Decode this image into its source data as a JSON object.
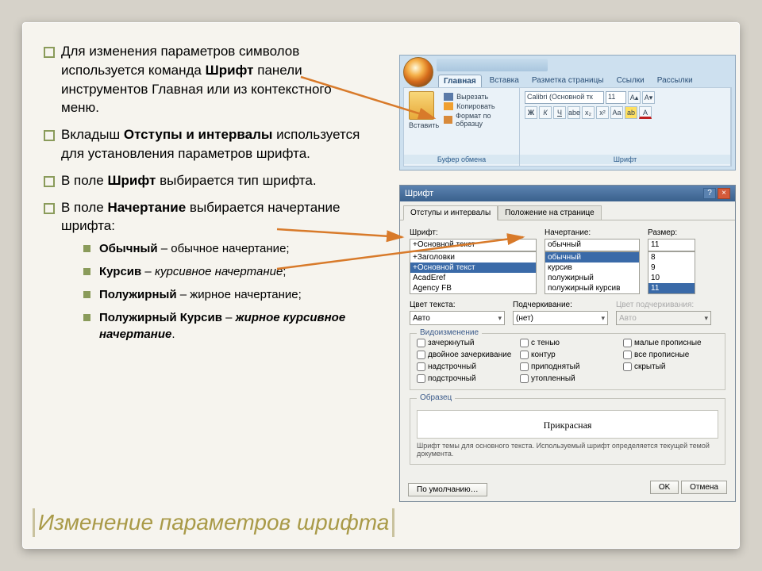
{
  "title": "Изменение параметров шрифта",
  "bullets": {
    "b1_pre": "Для изменения параметров символов используется команда ",
    "b1_bold": "Шрифт",
    "b1_post": " панели инструментов Главная или из контекстного меню.",
    "b2_pre": "Вкладыш ",
    "b2_bold": "Отступы и интервалы",
    "b2_post": " используется для установления параметров шрифта.",
    "b3_pre": "В поле  ",
    "b3_bold": "Шрифт",
    "b3_post": " выбирается тип шрифта.",
    "b4_pre": "В поле   ",
    "b4_bold": "Начертание",
    "b4_post": " выбирается начертание шрифта:",
    "i1_bold": "Обычный",
    "i1_post": " – обычное начертание;",
    "i2_bold": "Курсив",
    "i2_post": " – ",
    "i2_ital": "курсивное начертание",
    "i2_end": ";",
    "i3_bold": "Полужирный",
    "i3_post": " – жирное начертание;",
    "i4_bold": "Полужирный Курсив",
    "i4_post": " – ",
    "i4_bi": "жирное курсивное начертание",
    "i4_end": "."
  },
  "ribbon": {
    "tabs": [
      "Главная",
      "Вставка",
      "Разметка страницы",
      "Ссылки",
      "Рассылки"
    ],
    "paste": "Вставить",
    "cut": "Вырезать",
    "copy": "Копировать",
    "format": "Формат по образцу",
    "group_clip": "Буфер обмена",
    "group_font": "Шрифт",
    "fontname": "Calibri (Основной тк",
    "fontsize": "11"
  },
  "dlg": {
    "title": "Шрифт",
    "tabs": [
      "Отступы и интервалы",
      "Положение на странице"
    ],
    "labels": {
      "font": "Шрифт:",
      "style": "Начертание:",
      "size": "Размер:",
      "color": "Цвет текста:",
      "underline": "Подчеркивание:",
      "ucolor": "Цвет подчеркивания:"
    },
    "font_val": "+Основной текст",
    "font_list": [
      "+Заголовки",
      "+Основной текст",
      "AcadEref",
      "Agency FB"
    ],
    "style_val": "обычный",
    "style_list": [
      "обычный",
      "курсив",
      "полужирный",
      "полужирный курсив"
    ],
    "size_val": "11",
    "size_list": [
      "8",
      "9",
      "10",
      "11"
    ],
    "color_val": "Авто",
    "under_val": "(нет)",
    "ucolor_val": "Авто",
    "group_vid": "Видоизменение",
    "chk": [
      "зачеркнутый",
      "с тенью",
      "малые прописные",
      "двойное зачеркивание",
      "контур",
      "все прописные",
      "надстрочный",
      "приподнятый",
      "скрытый",
      "подстрочный",
      "утопленный"
    ],
    "group_sample": "Образец",
    "sample": "Прикрасная",
    "footnote": "Шрифт темы для основного текста. Используемый шрифт определяется текущей темой документа.",
    "btn_default": "По умолчанию…",
    "btn_ok": "OK",
    "btn_cancel": "Отмена"
  }
}
